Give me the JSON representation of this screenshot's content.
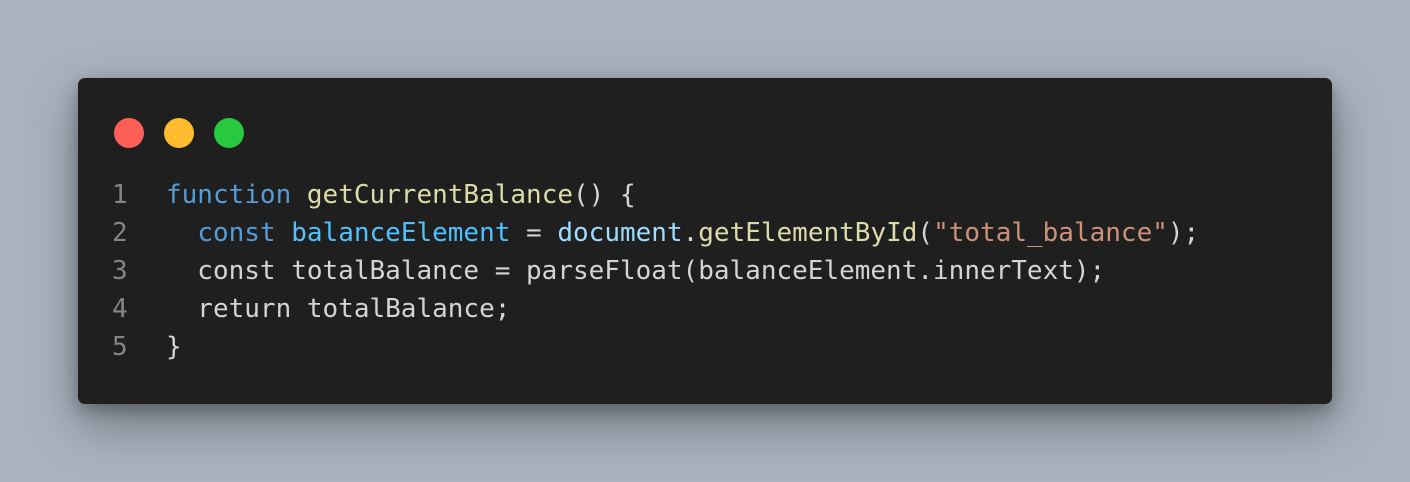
{
  "window": {
    "controls": [
      "close",
      "minimize",
      "maximize"
    ]
  },
  "code": {
    "lines": [
      {
        "number": "1",
        "tokens": [
          {
            "text": "function",
            "kind": "keyword"
          },
          {
            "text": " ",
            "kind": "plain"
          },
          {
            "text": "getCurrentBalance",
            "kind": "function"
          },
          {
            "text": "() {",
            "kind": "plain"
          }
        ]
      },
      {
        "number": "2",
        "tokens": [
          {
            "text": "  ",
            "kind": "plain"
          },
          {
            "text": "const",
            "kind": "keyword"
          },
          {
            "text": " ",
            "kind": "plain"
          },
          {
            "text": "balanceElement",
            "kind": "variable"
          },
          {
            "text": " = ",
            "kind": "plain"
          },
          {
            "text": "document",
            "kind": "property"
          },
          {
            "text": ".",
            "kind": "plain"
          },
          {
            "text": "getElementById",
            "kind": "function"
          },
          {
            "text": "(",
            "kind": "plain"
          },
          {
            "text": "\"total_balance\"",
            "kind": "string"
          },
          {
            "text": ");",
            "kind": "plain"
          }
        ]
      },
      {
        "number": "3",
        "tokens": [
          {
            "text": "  const totalBalance = parseFloat(balanceElement.innerText);",
            "kind": "plain"
          }
        ]
      },
      {
        "number": "4",
        "tokens": [
          {
            "text": "  return totalBalance;",
            "kind": "plain"
          }
        ]
      },
      {
        "number": "5",
        "tokens": [
          {
            "text": "}",
            "kind": "plain"
          }
        ]
      }
    ]
  },
  "colors": {
    "background": "#a9b3bf",
    "window": "#1f1f1f",
    "close": "#ff5f57",
    "minimize": "#febc2e",
    "maximize": "#28c840",
    "keyword": "#569cd6",
    "function": "#dcdcaa",
    "variable": "#4fc1ff",
    "property": "#9cdcfe",
    "string": "#ce9178",
    "plain": "#d4d4d4",
    "line_number": "#858585"
  }
}
